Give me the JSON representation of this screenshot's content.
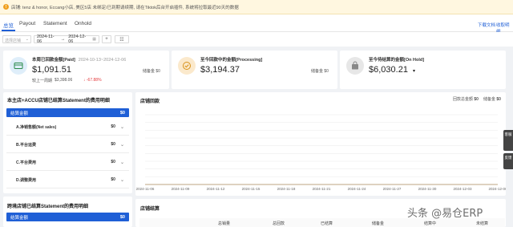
{
  "notice": {
    "text": "店铺: tenz & honor, Eccang小店, 美区5店 未绑定/已到期请续期, 请在Tiktok后台开启插件, 系统将拉取最近90天的数据"
  },
  "tabs": [
    {
      "label": "总览",
      "active": true
    },
    {
      "label": "Payout",
      "active": false
    },
    {
      "label": "Statement",
      "active": false
    },
    {
      "label": "Onhold",
      "active": false
    }
  ],
  "top_links": {
    "download": "下载文档",
    "fee": "收取明细"
  },
  "toolbar": {
    "store_placeholder": "选择店铺",
    "date_start": "2024-11-06",
    "date_sep": "→",
    "date_end": "2024-12-06",
    "add_btn": "+",
    "grid_btn": "☷"
  },
  "stats": [
    {
      "label": "本周已回款金额[Paid]",
      "date": "2024-10-13~2024-12-06",
      "value": "$1,091.51",
      "right_label": "储备金 $0",
      "compare_label": "较上一周期",
      "compare_value": "$3,398.06",
      "change": "↓ -67.88%"
    },
    {
      "label": "至今回款中的金额[Processing]",
      "value": "$3,194.37",
      "right_label": "储备金 $0"
    },
    {
      "label": "至今待结算的金额[On Hold]",
      "value": "$6,030.21",
      "caret": "▾"
    }
  ],
  "statement_panel": {
    "title": "本主店+ACCU店铺已结算Statement的费用明细",
    "total_label": "结算金额",
    "total_value": "$0",
    "rows": [
      {
        "label": "A.净销售额(Net sales)",
        "value": "$0"
      },
      {
        "label": "B.平台运费",
        "value": "$0"
      },
      {
        "label": "C.平台费用",
        "value": "$0"
      },
      {
        "label": "D.调整费用",
        "value": "$0"
      }
    ]
  },
  "cross_panel": {
    "title": "跨境店铺已结算Statement的费用明细",
    "total_label": "结算金额",
    "total_value": "$0"
  },
  "trend": {
    "title": "店铺回款",
    "legend": [
      {
        "label": "回款总金额",
        "value": "$0"
      },
      {
        "label": "储备金",
        "value": "$0"
      }
    ]
  },
  "chart_data": {
    "type": "line",
    "title": "店铺回款",
    "x": [
      "2024-11-06",
      "2024-11-09",
      "2024-11-12",
      "2024-11-15",
      "2024-11-18",
      "2024-11-21",
      "2024-11-24",
      "2024-11-27",
      "2024-11-30",
      "2024-12-03",
      "2024-12-06"
    ],
    "series": [
      {
        "name": "回款总金额",
        "values": [
          0,
          0,
          0,
          0,
          0,
          0,
          0,
          0,
          0,
          0,
          0
        ]
      },
      {
        "name": "储备金",
        "values": [
          0,
          0,
          0,
          0,
          0,
          0,
          0,
          0,
          0,
          0,
          0
        ]
      }
    ],
    "grid": true
  },
  "store_table": {
    "title": "店铺结算",
    "columns": [
      "总销量",
      "总回款",
      "已结算",
      "储备金",
      "结算中",
      "未结算"
    ]
  },
  "side_buttons": {
    "top": "客服",
    "bottom": "反馈"
  },
  "watermark": "头条 @易仓ERP"
}
